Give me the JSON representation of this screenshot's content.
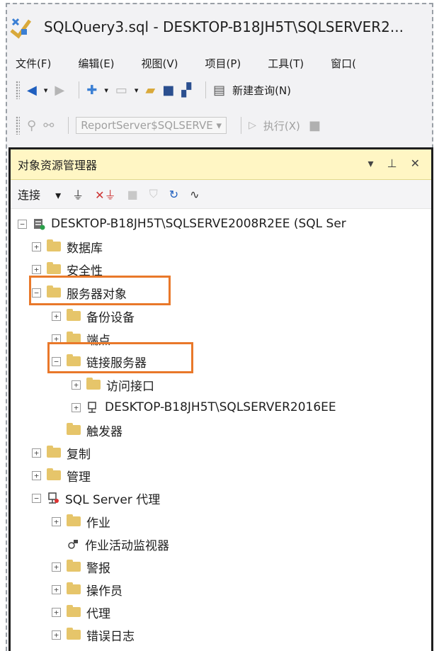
{
  "window": {
    "title": "SQLQuery3.sql - DESKTOP-B18JH5T\\SQLSERVER2..."
  },
  "menu": [
    "文件(F)",
    "编辑(E)",
    "视图(V)",
    "项目(P)",
    "工具(T)",
    "窗口("
  ],
  "toolbar": {
    "new_query_label": "新建查询(N)"
  },
  "toolbar2": {
    "server_combo": "ReportServer$SQLSERVE",
    "execute_label": "执行(X)"
  },
  "object_explorer": {
    "title": "对象资源管理器",
    "connect_label": "连接",
    "tree": [
      {
        "label": "DESKTOP-B18JH5T\\SQLSERVE2008R2EE (SQL Ser",
        "expander": "−",
        "icon": "server-icon"
      },
      {
        "label": "数据库",
        "expander": "+",
        "icon": "folder-icon"
      },
      {
        "label": "安全性",
        "expander": "+",
        "icon": "folder-icon"
      },
      {
        "label": "服务器对象",
        "expander": "−",
        "icon": "folder-icon"
      },
      {
        "label": "备份设备",
        "expander": "+",
        "icon": "folder-icon"
      },
      {
        "label": "端点",
        "expander": "+",
        "icon": "folder-icon"
      },
      {
        "label": "链接服务器",
        "expander": "−",
        "icon": "folder-icon"
      },
      {
        "label": "访问接口",
        "expander": "+",
        "icon": "folder-icon"
      },
      {
        "label": "DESKTOP-B18JH5T\\SQLSERVER2016EE",
        "expander": "+",
        "icon": "linked-server-icon"
      },
      {
        "label": "触发器",
        "expander": "",
        "icon": "folder-icon"
      },
      {
        "label": "复制",
        "expander": "+",
        "icon": "folder-icon"
      },
      {
        "label": "管理",
        "expander": "+",
        "icon": "folder-icon"
      },
      {
        "label": "SQL Server 代理",
        "expander": "−",
        "icon": "agent-icon"
      },
      {
        "label": "作业",
        "expander": "+",
        "icon": "folder-icon"
      },
      {
        "label": "作业活动监视器",
        "expander": "",
        "icon": "monitor-icon"
      },
      {
        "label": "警报",
        "expander": "+",
        "icon": "folder-icon"
      },
      {
        "label": "操作员",
        "expander": "+",
        "icon": "folder-icon"
      },
      {
        "label": "代理",
        "expander": "+",
        "icon": "folder-icon"
      },
      {
        "label": "错误日志",
        "expander": "+",
        "icon": "folder-icon"
      }
    ]
  },
  "colors": {
    "highlight": "#e9782a",
    "panel_header": "#fff6c4",
    "folder": "#e6c56a"
  }
}
